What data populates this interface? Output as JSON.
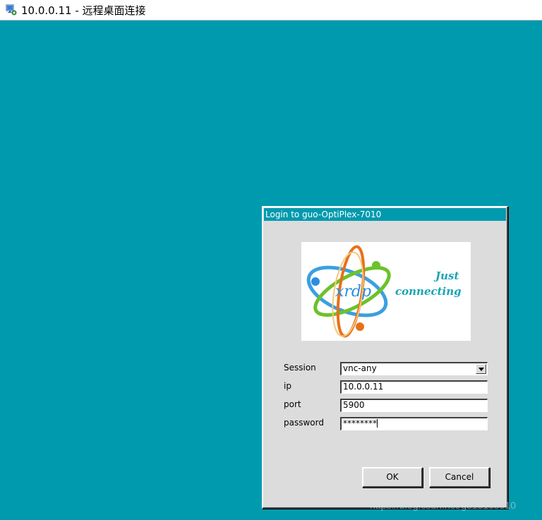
{
  "window": {
    "title": "10.0.0.11 - 远程桌面连接",
    "icon": "remote-desktop-icon"
  },
  "dialog": {
    "title": "Login to guo-OptiPlex-7010",
    "logo": {
      "name": "xrdp",
      "tagline_line1": "Just",
      "tagline_line2": "connecting"
    },
    "fields": {
      "session": {
        "label": "Session",
        "value": "vnc-any"
      },
      "ip": {
        "label": "ip",
        "value": "10.0.0.11"
      },
      "port": {
        "label": "port",
        "value": "5900"
      },
      "password": {
        "label": "password",
        "value": "********"
      }
    },
    "buttons": {
      "ok": "OK",
      "cancel": "Cancel"
    }
  },
  "watermark": "https://blog.csdn.net/g313105910",
  "colors": {
    "desktop": "#009aaf",
    "dialog_bg": "#dcdcdc",
    "dialog_title_bg": "#009aaf"
  }
}
